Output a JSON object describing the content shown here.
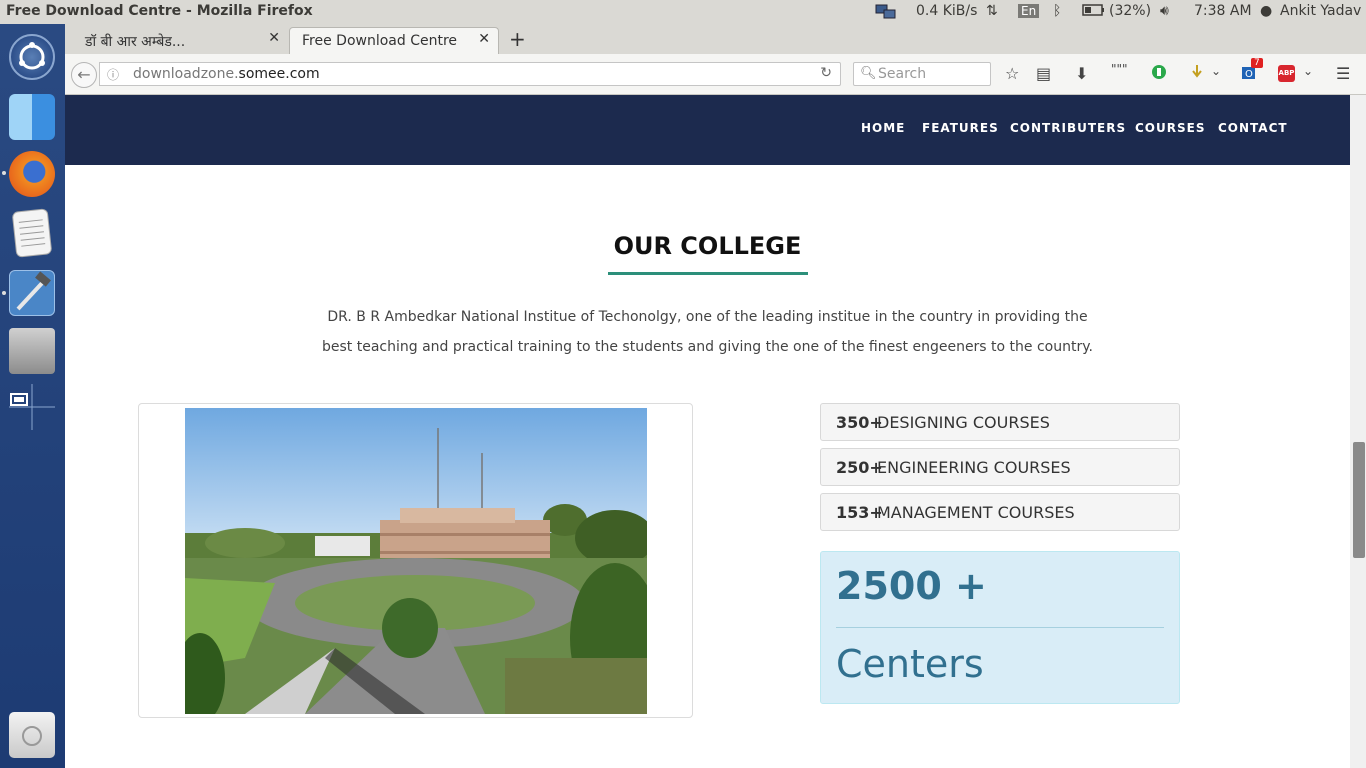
{
  "os_panel": {
    "window_title": "Free Download Centre - Mozilla Firefox",
    "net_speed": "0.4 KiB/s",
    "keyboard_layout": "En",
    "battery": "(32%)",
    "time": "7:38 AM",
    "user": "Ankit Yadav"
  },
  "launcher": {
    "items": [
      "ubuntu-dash-icon",
      "finder-icon",
      "firefox-icon",
      "text-editor-icon",
      "xcode-icon",
      "disk-icon",
      "workspace-switcher-icon",
      "trash-icon"
    ]
  },
  "browser": {
    "tabs": [
      {
        "label": "डॉ बी आर अम्बेड..."
      },
      {
        "label": "Free Download Centre"
      }
    ],
    "url_prefix": "downloadzone.",
    "url_domain": "somee.com",
    "search_placeholder": "Search",
    "badge_count": "7",
    "abp_label": "ABP"
  },
  "site": {
    "nav": [
      "HOME",
      "FEATURES",
      "CONTRIBUTERS",
      "COURSES",
      "CONTACT"
    ],
    "section_title": "OUR COLLEGE",
    "intro_line1": "DR. B R Ambedkar National Institue of Techonolgy, one of the leading institue in the country in providing the",
    "intro_line2": "best teaching and practical training to the students and giving the one of the finest engeeners to the country.",
    "stats": [
      {
        "num": "350+",
        "label": "DESIGNING COURSES"
      },
      {
        "num": "250+",
        "label": "ENGINEERING COURSES"
      },
      {
        "num": "153+",
        "label": "MANAGEMENT COURSES"
      }
    ],
    "big_number": "2500 +",
    "big_label": "Centers"
  },
  "colors": {
    "nav_bg": "#1c2a4e",
    "accent_underline": "#2c8f7a",
    "info_bg": "#d9edf7",
    "info_text": "#31708f"
  }
}
